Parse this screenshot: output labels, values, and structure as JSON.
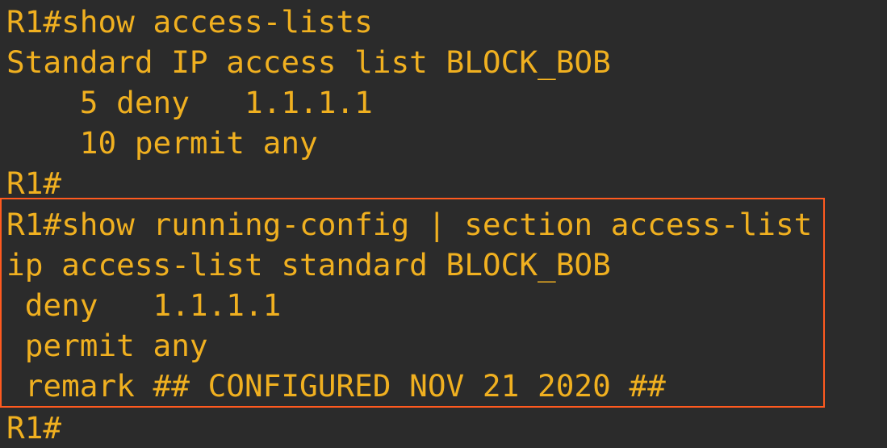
{
  "terminal": {
    "lines": [
      "R1#show access-lists",
      "Standard IP access list BLOCK_BOB",
      "    5 deny   1.1.1.1",
      "    10 permit any",
      "R1#",
      "R1#show running-config | section access-list",
      "ip access-list standard BLOCK_BOB",
      " deny   1.1.1.1",
      " permit any",
      " remark ## CONFIGURED NOV 21 2020 ##",
      "R1#"
    ]
  },
  "colors": {
    "background": "#2b2b2b",
    "text": "#f0b020",
    "highlight_border": "#ff5a1f"
  }
}
